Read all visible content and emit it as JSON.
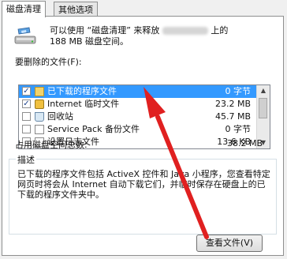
{
  "tabs": [
    {
      "label": "磁盘清理",
      "active": true
    },
    {
      "label": "其他选项",
      "active": false
    }
  ],
  "intro": {
    "line1_prefix": "可以使用 “磁盘清理” 来释放",
    "line1_suffix": "上的",
    "line2": "188 MB 磁盘空间。"
  },
  "files_to_delete_label": "要删除的文件(F):",
  "files": [
    {
      "name": "已下载的程序文件",
      "size": "0 字节",
      "checked": true,
      "selected": true,
      "icon": "folder-icon"
    },
    {
      "name": "Internet 临时文件",
      "size": "23.2 MB",
      "checked": true,
      "selected": false,
      "icon": "lock-icon"
    },
    {
      "name": "回收站",
      "size": "45.7 MB",
      "checked": false,
      "selected": false,
      "icon": "recycle-bin-icon"
    },
    {
      "name": "Service Pack 备份文件",
      "size": "0 字节",
      "checked": false,
      "selected": false,
      "icon": "document-icon"
    },
    {
      "name": "设置日志文件",
      "size": "13.6 KB",
      "checked": false,
      "selected": false,
      "icon": "document-icon"
    }
  ],
  "space_gained_label": "占用磁盘空间总数:",
  "space_gained_value": "38.2 MB",
  "description_title": "描述",
  "description_text": "已下载的程序文件包括 ActiveX 控件和 Java 小程序，您查看特定网页时将会从 Internet 自动下载它们，并临时保存在硬盘上的已下载的程序文件夹中。",
  "view_files_button": "查看文件(V)",
  "colors": {
    "selection": "#3399ff",
    "annotation_arrow": "#e02020"
  }
}
